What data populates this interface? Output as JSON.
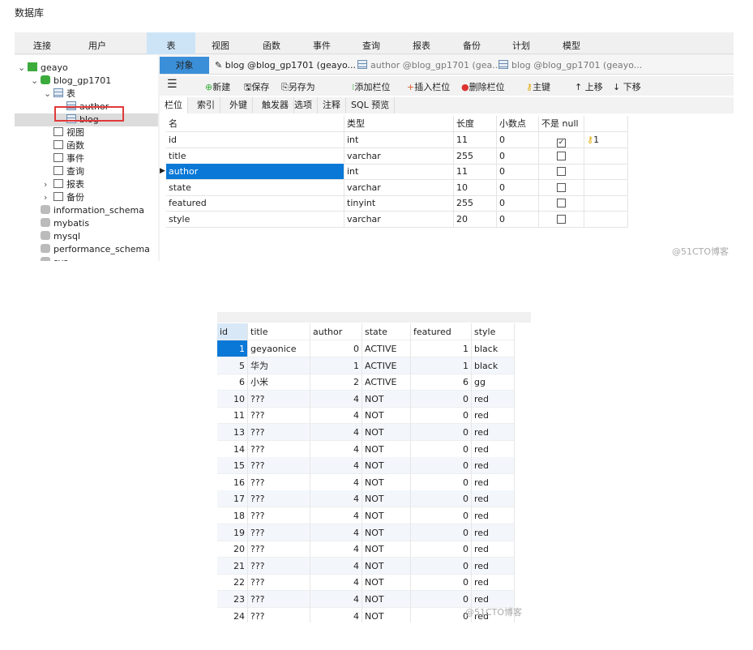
{
  "page_title": "数据库",
  "app": {
    "ribbon": [
      "连接",
      "用户",
      "表",
      "视图",
      "函数",
      "事件",
      "查询",
      "报表",
      "备份",
      "计划",
      "模型"
    ],
    "ribbon_selected": "表",
    "tree": [
      {
        "label": "geayo",
        "level": 0,
        "icon": "connection-icon",
        "expanded": true
      },
      {
        "label": "blog_gp1701",
        "level": 1,
        "icon": "database-icon",
        "expanded": true
      },
      {
        "label": "表",
        "level": 2,
        "icon": "table-icon",
        "expanded": true
      },
      {
        "label": "author",
        "level": 3,
        "icon": "table-icon"
      },
      {
        "label": "blog",
        "level": 3,
        "icon": "table-icon",
        "selected": true
      },
      {
        "label": "视图",
        "level": 2,
        "icon": "view-icon"
      },
      {
        "label": "函数",
        "level": 2,
        "icon": "function-icon"
      },
      {
        "label": "事件",
        "level": 2,
        "icon": "event-icon"
      },
      {
        "label": "查询",
        "level": 2,
        "icon": "query-icon"
      },
      {
        "label": "报表",
        "level": 2,
        "icon": "report-icon",
        "collapsed": true
      },
      {
        "label": "备份",
        "level": 2,
        "icon": "backup-icon",
        "collapsed": true
      },
      {
        "label": "information_schema",
        "level": 1,
        "icon": "database-icon"
      },
      {
        "label": "mybatis",
        "level": 1,
        "icon": "database-icon"
      },
      {
        "label": "mysql",
        "level": 1,
        "icon": "database-icon"
      },
      {
        "label": "performance_schema",
        "level": 1,
        "icon": "database-icon"
      },
      {
        "label": "sys",
        "level": 1,
        "icon": "database-icon"
      }
    ],
    "tabs": {
      "objects": "对象",
      "t1": "blog @blog_gp1701 (geayo...",
      "t2": "author @blog_gp1701 (gea...",
      "t3": "blog @blog_gp1701 (geayo..."
    },
    "toolbar": {
      "new": "新建",
      "save": "保存",
      "save_as": "另存为",
      "add_field": "添加栏位",
      "insert_field": "插入栏位",
      "delete_field": "删除栏位",
      "primary_key": "主键",
      "move_up": "上移",
      "move_down": "下移"
    },
    "subtabs": [
      "栏位",
      "索引",
      "外键",
      "触发器",
      "选项",
      "注释",
      "SQL 预览"
    ],
    "columns": [
      "名",
      "类型",
      "长度",
      "小数点",
      "不是 null",
      ""
    ],
    "fields": [
      [
        "id",
        "int",
        "11",
        "0",
        true,
        "1"
      ],
      [
        "title",
        "varchar",
        "255",
        "0",
        false,
        ""
      ],
      [
        "author",
        "int",
        "11",
        "0",
        false,
        ""
      ],
      [
        "state",
        "varchar",
        "10",
        "0",
        false,
        ""
      ],
      [
        "featured",
        "tinyint",
        "255",
        "0",
        false,
        ""
      ],
      [
        "style",
        "varchar",
        "20",
        "0",
        false,
        ""
      ]
    ],
    "selected_field": "author",
    "watermark": "@51CTO博客"
  },
  "result": {
    "columns": [
      "id",
      "title",
      "author",
      "state",
      "featured",
      "style"
    ],
    "rows": [
      [
        "1",
        "geyaonice",
        "0",
        "ACTIVE",
        "1",
        "black"
      ],
      [
        "5",
        "华为",
        "1",
        "ACTIVE",
        "1",
        "black"
      ],
      [
        "6",
        "小米",
        "2",
        "ACTIVE",
        "6",
        "gg"
      ],
      [
        "10",
        "???",
        "4",
        "NOT",
        "0",
        "red"
      ],
      [
        "11",
        "???",
        "4",
        "NOT",
        "0",
        "red"
      ],
      [
        "13",
        "???",
        "4",
        "NOT",
        "0",
        "red"
      ],
      [
        "14",
        "???",
        "4",
        "NOT",
        "0",
        "red"
      ],
      [
        "15",
        "???",
        "4",
        "NOT",
        "0",
        "red"
      ],
      [
        "16",
        "???",
        "4",
        "NOT",
        "0",
        "red"
      ],
      [
        "17",
        "???",
        "4",
        "NOT",
        "0",
        "red"
      ],
      [
        "18",
        "???",
        "4",
        "NOT",
        "0",
        "red"
      ],
      [
        "19",
        "???",
        "4",
        "NOT",
        "0",
        "red"
      ],
      [
        "20",
        "???",
        "4",
        "NOT",
        "0",
        "red"
      ],
      [
        "21",
        "???",
        "4",
        "NOT",
        "0",
        "red"
      ],
      [
        "22",
        "???",
        "4",
        "NOT",
        "0",
        "red"
      ],
      [
        "23",
        "???",
        "4",
        "NOT",
        "0",
        "red"
      ],
      [
        "24",
        "???",
        "4",
        "NOT",
        "0",
        "red"
      ]
    ],
    "watermark": "@51CTO博客"
  },
  "colors": {
    "selection": "#0a78d7",
    "highlight_box": "#e03a3a",
    "ribbon_selected": "#cde4f7"
  }
}
